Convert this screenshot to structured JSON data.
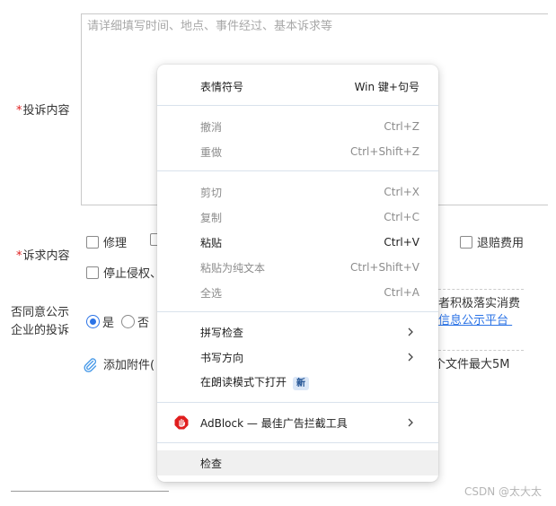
{
  "form": {
    "textarea_placeholder": "请详细填写时间、地点、事件经过、基本诉求等",
    "complaint_label_required": "*",
    "complaint_label": "投诉内容",
    "demand_label_required": "*",
    "demand_label": "诉求内容",
    "demands": [
      "修理",
      "退赔费用",
      "停止侵权、"
    ],
    "disclosure_label_line1": "否同意公示",
    "disclosure_label_line2": "企业的投诉",
    "radio_yes": "是",
    "radio_no": "否",
    "notice_text": "者积极落实消费",
    "notice_link": "信息公示平台",
    "attach_label": "添加附件(",
    "attach_limit": "个文件最大5M"
  },
  "watermark": "CSDN @太大太",
  "context_menu": {
    "emoji": {
      "label": "表情符号",
      "shortcut": "Win 键+句号"
    },
    "undo": {
      "label": "撤消",
      "shortcut": "Ctrl+Z"
    },
    "redo": {
      "label": "重做",
      "shortcut": "Ctrl+Shift+Z"
    },
    "cut": {
      "label": "剪切",
      "shortcut": "Ctrl+X"
    },
    "copy": {
      "label": "复制",
      "shortcut": "Ctrl+C"
    },
    "paste": {
      "label": "粘贴",
      "shortcut": "Ctrl+V"
    },
    "paste_plain": {
      "label": "粘贴为纯文本",
      "shortcut": "Ctrl+Shift+V"
    },
    "select_all": {
      "label": "全选",
      "shortcut": "Ctrl+A"
    },
    "spellcheck": {
      "label": "拼写检查"
    },
    "writing_direction": {
      "label": "书写方向"
    },
    "reading_mode": {
      "label": "在朗读模式下打开",
      "badge": "新"
    },
    "adblock": {
      "label": "AdBlock — 最佳广告拦截工具"
    },
    "inspect": {
      "label": "检查"
    }
  },
  "colors": {
    "accent": "#2b73e6",
    "required": "#e02020",
    "adblock": "#e01e1e"
  }
}
